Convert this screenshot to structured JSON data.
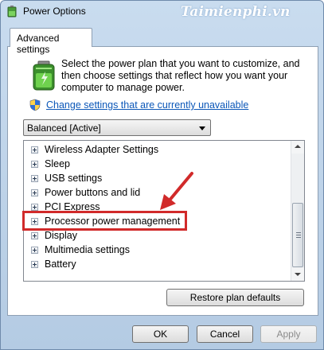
{
  "window": {
    "title": "Power Options",
    "watermark": "Taimienphi.vn"
  },
  "tab": {
    "label": "Advanced settings"
  },
  "panel": {
    "description": "Select the power plan that you want to customize, and then choose settings that reflect how you want your computer to manage power.",
    "change_link": "Change settings that are currently unavailable",
    "plan_select": {
      "value": "Balanced [Active]"
    }
  },
  "tree": {
    "items": [
      {
        "label": "Wireless Adapter Settings"
      },
      {
        "label": "Sleep"
      },
      {
        "label": "USB settings"
      },
      {
        "label": "Power buttons and lid"
      },
      {
        "label": "PCI Express"
      },
      {
        "label": "Processor power management"
      },
      {
        "label": "Display"
      },
      {
        "label": "Multimedia settings"
      },
      {
        "label": "Battery"
      }
    ]
  },
  "buttons": {
    "restore": "Restore plan defaults",
    "ok": "OK",
    "cancel": "Cancel",
    "apply": "Apply"
  },
  "colors": {
    "link": "#0b57b8",
    "highlight": "#d12a2a"
  },
  "icons": {
    "app": "power-options-icon",
    "battery": "battery-icon",
    "shield": "uac-shield-icon"
  }
}
